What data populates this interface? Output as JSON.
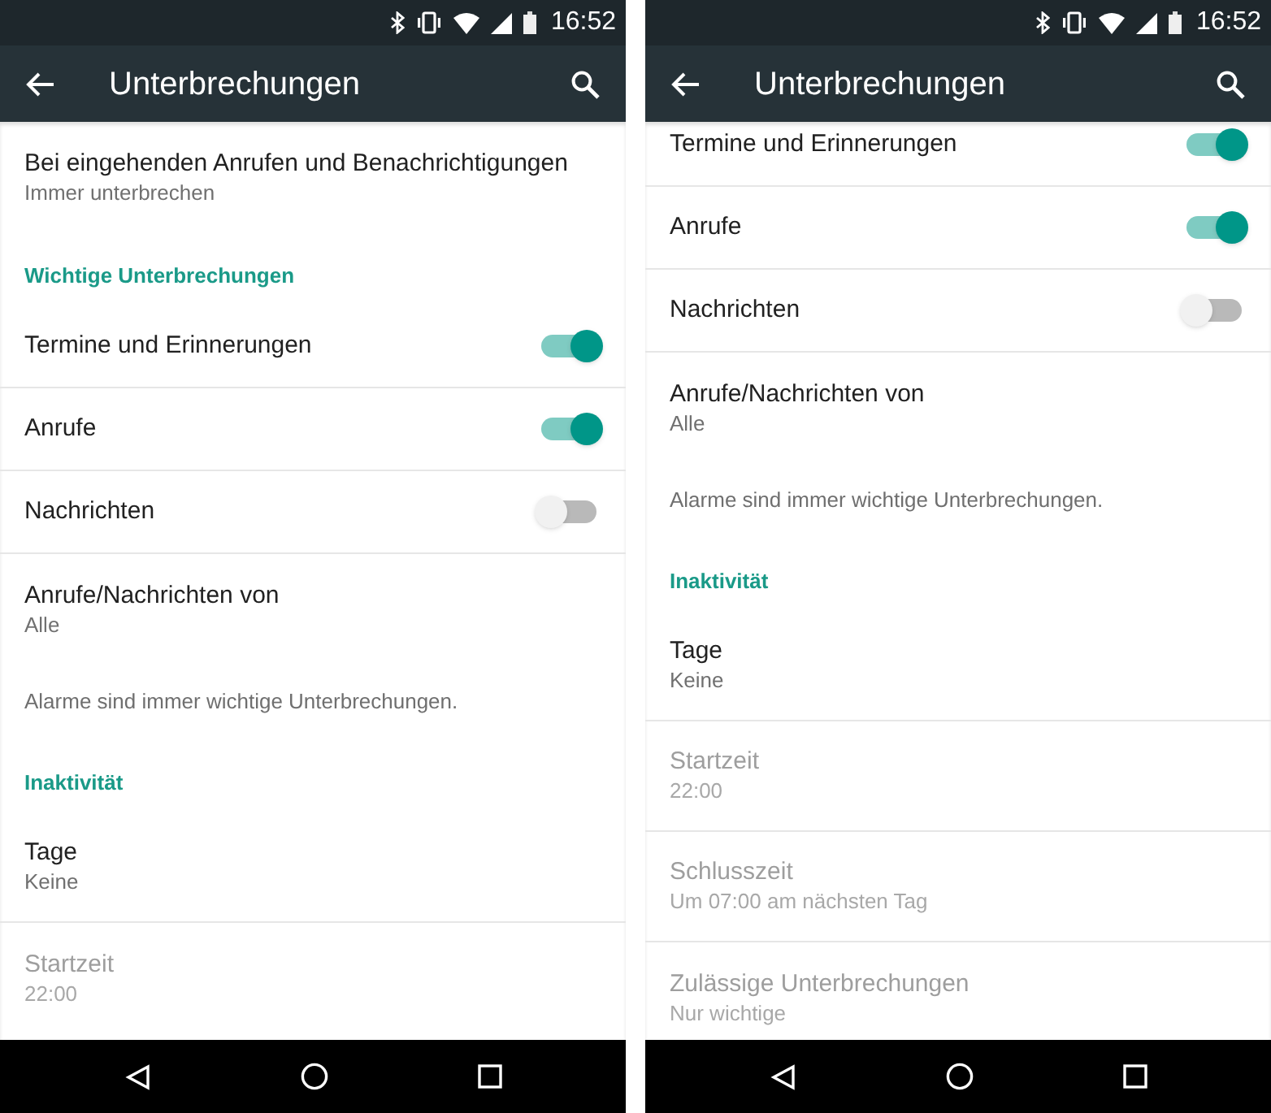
{
  "screens": [
    {
      "status_bar": {
        "time": "16:52"
      },
      "toolbar": {
        "title": "Unterbrechungen"
      },
      "scrolled": false,
      "items": [
        {
          "kind": "setting",
          "title": "Bei eingehenden Anrufen und Benachrichtigungen",
          "summary": "Immer unterbrechen",
          "disabled": false
        },
        {
          "kind": "header",
          "title": "Wichtige Unterbrechungen"
        },
        {
          "kind": "toggle",
          "title": "Termine und Erinnerungen",
          "on": true
        },
        {
          "kind": "toggle",
          "title": "Anrufe",
          "on": true
        },
        {
          "kind": "toggle",
          "title": "Nachrichten",
          "on": false
        },
        {
          "kind": "setting",
          "title": "Anrufe/Nachrichten von",
          "summary": "Alle",
          "disabled": false
        },
        {
          "kind": "note",
          "title": "Alarme sind immer wichtige Unterbrechungen."
        },
        {
          "kind": "header",
          "title": "Inaktivität"
        },
        {
          "kind": "setting",
          "title": "Tage",
          "summary": "Keine",
          "disabled": false
        },
        {
          "kind": "setting",
          "title": "Startzeit",
          "summary": "22:00",
          "disabled": true
        }
      ]
    },
    {
      "status_bar": {
        "time": "16:52"
      },
      "toolbar": {
        "title": "Unterbrechungen"
      },
      "scrolled": true,
      "items": [
        {
          "kind": "toggle",
          "title": "Termine und Erinnerungen",
          "on": true
        },
        {
          "kind": "toggle",
          "title": "Anrufe",
          "on": true
        },
        {
          "kind": "toggle",
          "title": "Nachrichten",
          "on": false
        },
        {
          "kind": "setting",
          "title": "Anrufe/Nachrichten von",
          "summary": "Alle",
          "disabled": false
        },
        {
          "kind": "note",
          "title": "Alarme sind immer wichtige Unterbrechungen."
        },
        {
          "kind": "header",
          "title": "Inaktivität"
        },
        {
          "kind": "setting",
          "title": "Tage",
          "summary": "Keine",
          "disabled": false
        },
        {
          "kind": "setting",
          "title": "Startzeit",
          "summary": "22:00",
          "disabled": true
        },
        {
          "kind": "setting",
          "title": "Schlusszeit",
          "summary": "Um 07:00 am nächsten Tag",
          "disabled": true
        },
        {
          "kind": "setting",
          "title": "Zulässige Unterbrechungen",
          "summary": "Nur wichtige",
          "disabled": true
        }
      ]
    }
  ]
}
